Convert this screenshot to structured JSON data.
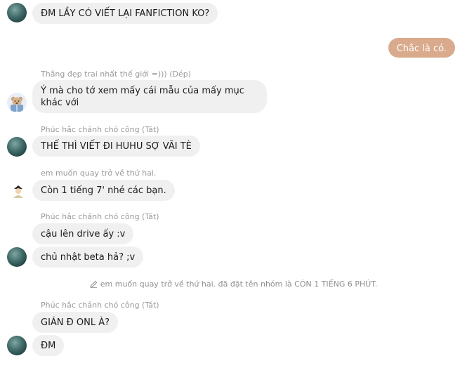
{
  "colors": {
    "incoming_bubble": "#f0f0f0",
    "outgoing_bubble": "#d9aa8c",
    "sender_name": "#9a9a9a"
  },
  "messages": {
    "m1": "ĐM LẦY CÓ VIẾT LẠI FANFICTION KO?",
    "m2": "Chắc là có.",
    "m3_sender": "Thắng đẹp trai nhất thế giới =))) (Dép)",
    "m3": "Ý mà cho tớ xem mấy cái mẫu của mấy mục khác với",
    "m4_sender": "Phúc hắc chảnh chó công (Tát)",
    "m4": "THẾ THÌ VIẾT ĐI HUHU SỢ VÃI TÈ",
    "m5_sender": "em muốn quay trở về thứ hai.",
    "m5": "Còn 1 tiếng 7' nhé các bạn.",
    "m6_sender": "Phúc hắc chảnh chó công (Tát)",
    "m6a": "cậu lên drive ấy :v",
    "m6b": "chủ nhật beta hả? ;v",
    "system_note": "em muốn quay trở về thứ hai. đã đặt tên nhóm là CÒN 1 TIẾNG 6 PHÚT.",
    "m7_sender": "Phúc hắc chảnh chó công (Tát)",
    "m7a": "GIÁN Đ ONL À?",
    "m7b": "ĐM"
  },
  "icons": {
    "system_note": "pencil-icon"
  }
}
